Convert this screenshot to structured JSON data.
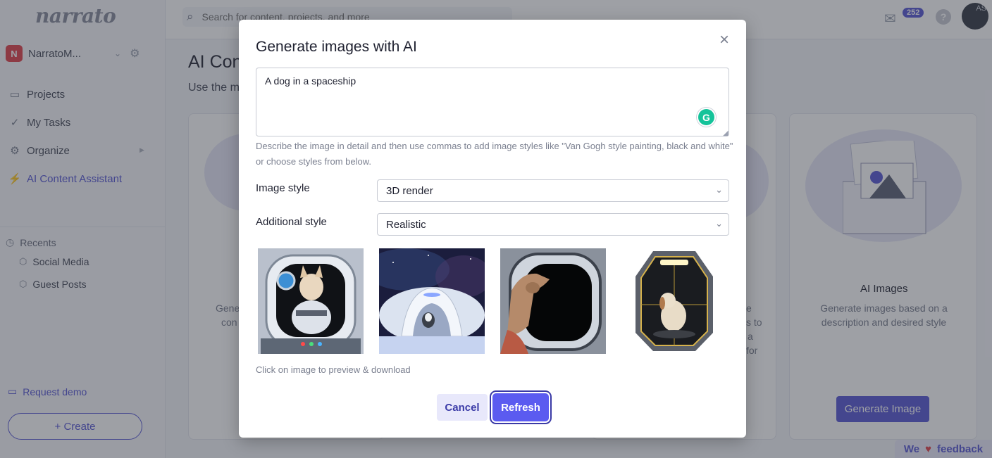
{
  "sidebar": {
    "logo": "narrato",
    "workspace": {
      "initial": "N",
      "name": "NarratoM..."
    },
    "nav": [
      {
        "label": "Projects"
      },
      {
        "label": "My Tasks"
      },
      {
        "label": "Organize"
      },
      {
        "label": "AI Content Assistant"
      }
    ],
    "recents_title": "Recents",
    "recents": [
      {
        "label": "Social Media"
      },
      {
        "label": "Guest Posts"
      }
    ],
    "request_demo": "Request demo",
    "create_label": "+ Create"
  },
  "header": {
    "search_placeholder": "Search for content, projects, and more",
    "mail_count": "252",
    "avatar_initials": "AS"
  },
  "background": {
    "page_title": "AI Con",
    "page_subtitle": "Use the m",
    "card1_text": [
      "Gene",
      "con"
    ],
    "card3_text": [
      "e",
      "s to",
      "a",
      "for"
    ],
    "ai_images_title": "AI Images",
    "ai_images_desc": "Generate images based on a description and desired style",
    "generate_image_label": "Generate Image",
    "feedback": {
      "before": "We",
      "after": "feedback"
    }
  },
  "modal": {
    "title": "Generate images with AI",
    "close_icon": "×",
    "prompt_value": "A dog in a spaceship",
    "prompt_hint": "Describe the image in detail and then use commas to add image styles like \"Van Gogh style painting, black and white\" or choose styles from below.",
    "image_style_label": "Image style",
    "image_style_value": "3D render",
    "additional_style_label": "Additional style",
    "additional_style_value": "Realistic",
    "images": [
      {
        "name": "dog-astronaut-window"
      },
      {
        "name": "husky-in-pod"
      },
      {
        "name": "dog-looking-portal"
      },
      {
        "name": "dog-in-hex-capsule"
      }
    ],
    "images_hint": "Click on image to preview & download",
    "cancel_label": "Cancel",
    "refresh_label": "Refresh"
  },
  "colors": {
    "accent": "#5b5bd6",
    "overlay": "rgba(40,44,56,0.45)",
    "danger": "#e0454f"
  }
}
